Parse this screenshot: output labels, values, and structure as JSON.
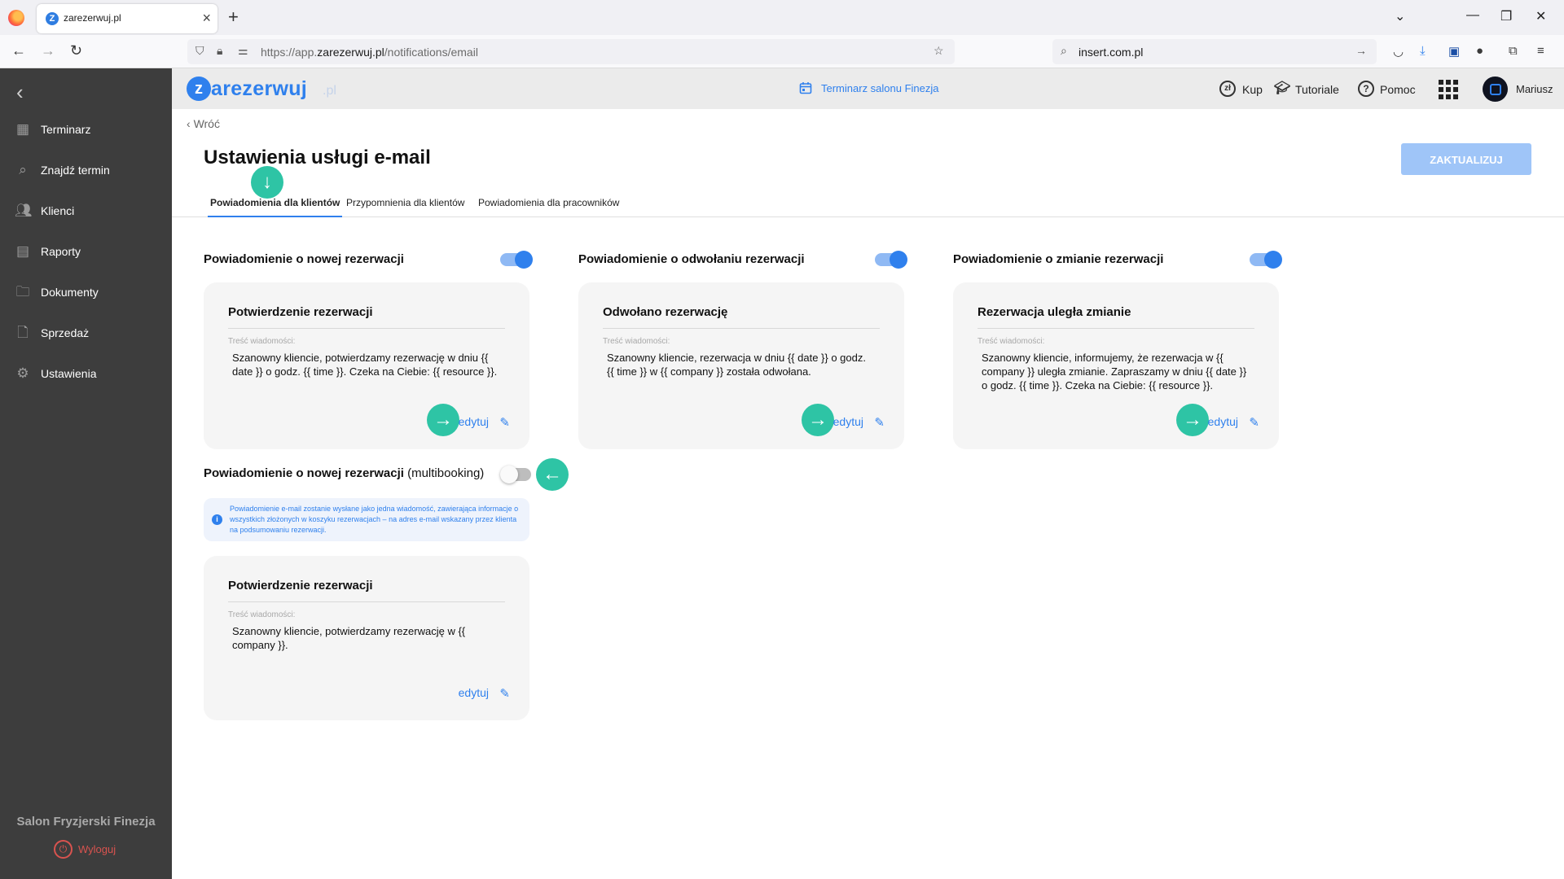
{
  "browser": {
    "tab_title": "zarezerwuj.pl",
    "tab_favicon": "Z",
    "url_prefix": "https://app.",
    "url_domain": "zarezerwuj.pl",
    "url_path": "/notifications/email",
    "search_text": "insert.com.pl"
  },
  "sidebar": {
    "items": [
      {
        "label": "Terminarz",
        "icon": "calendar-icon"
      },
      {
        "label": "Znajdź termin",
        "icon": "search-icon"
      },
      {
        "label": "Klienci",
        "icon": "users-icon"
      },
      {
        "label": "Raporty",
        "icon": "report-icon"
      },
      {
        "label": "Dokumenty",
        "icon": "folder-icon"
      },
      {
        "label": "Sprzedaż",
        "icon": "document-icon"
      },
      {
        "label": "Ustawienia",
        "icon": "gear-icon"
      }
    ],
    "salon_name": "Salon Fryzjerski Finezja",
    "logout_label": "Wyloguj"
  },
  "header": {
    "logo_word": "arezerwuj",
    "logo_z": "z",
    "logo_suffix": ".pl",
    "center_link": "Terminarz salonu Finezja",
    "buy_icon_text": "zł",
    "buy_label": "Kup",
    "tutorials_label": "Tutoriale",
    "help_label": "Pomoc",
    "user_name": "Mariusz"
  },
  "page": {
    "back_label": "Wróć",
    "title": "Ustawienia usługi e-mail",
    "update_button": "ZAKTUALIZUJ",
    "tabs": [
      {
        "label": "Powiadomienia dla klientów",
        "active": true
      },
      {
        "label": "Przypomnienia dla klientów",
        "active": false
      },
      {
        "label": "Powiadomienia dla pracowników",
        "active": false
      }
    ]
  },
  "sections": [
    {
      "title": "Powiadomienie o nowej rezerwacji",
      "enabled": true,
      "card_title": "Potwierdzenie rezerwacji",
      "content_label": "Treść wiadomości:",
      "content": "Szanowny kliencie,  potwierdzamy rezerwację w dniu {{ date }} o godz. {{ time }}. Czeka na Ciebie: {{ resource }}.",
      "edit_label": "edytuj"
    },
    {
      "title": "Powiadomienie o odwołaniu rezerwacji",
      "enabled": true,
      "card_title": "Odwołano rezerwację",
      "content_label": "Treść wiadomości:",
      "content": "Szanowny kliencie,  rezerwacja w dniu {{ date }} o godz. {{ time }} w {{ company }} została odwołana.",
      "edit_label": "edytuj"
    },
    {
      "title": "Powiadomienie o zmianie rezerwacji",
      "enabled": true,
      "card_title": "Rezerwacja uległa zmianie",
      "content_label": "Treść wiadomości:",
      "content": "Szanowny kliencie,  informujemy, że rezerwacja w {{ company }} uległa zmianie. Zapraszamy w dniu {{ date }} o godz. {{ time }}. Czeka na Ciebie: {{ resource }}.",
      "edit_label": "edytuj"
    }
  ],
  "multibooking": {
    "title": "Powiadomienie o nowej rezerwacji",
    "title_suffix": "(multibooking)",
    "enabled": false,
    "info": "Powiadomienie e-mail zostanie wysłane jako jedna wiadomość, zawierająca informacje o wszystkich złożonych w koszyku rezerwacjach – na adres e-mail wskazany przez klienta na podsumowaniu rezerwacji.",
    "card_title": "Potwierdzenie rezerwacji",
    "content_label": "Treść wiadomości:",
    "content": "Szanowny kliencie, potwierdzamy rezerwację w {{ company }}.",
    "edit_label": "edytuj"
  },
  "colors": {
    "accent": "#2f80ed",
    "sidebar_bg": "#3d3d3d",
    "annotation_green": "#2ec4a5",
    "logout_red": "#d9534f"
  }
}
